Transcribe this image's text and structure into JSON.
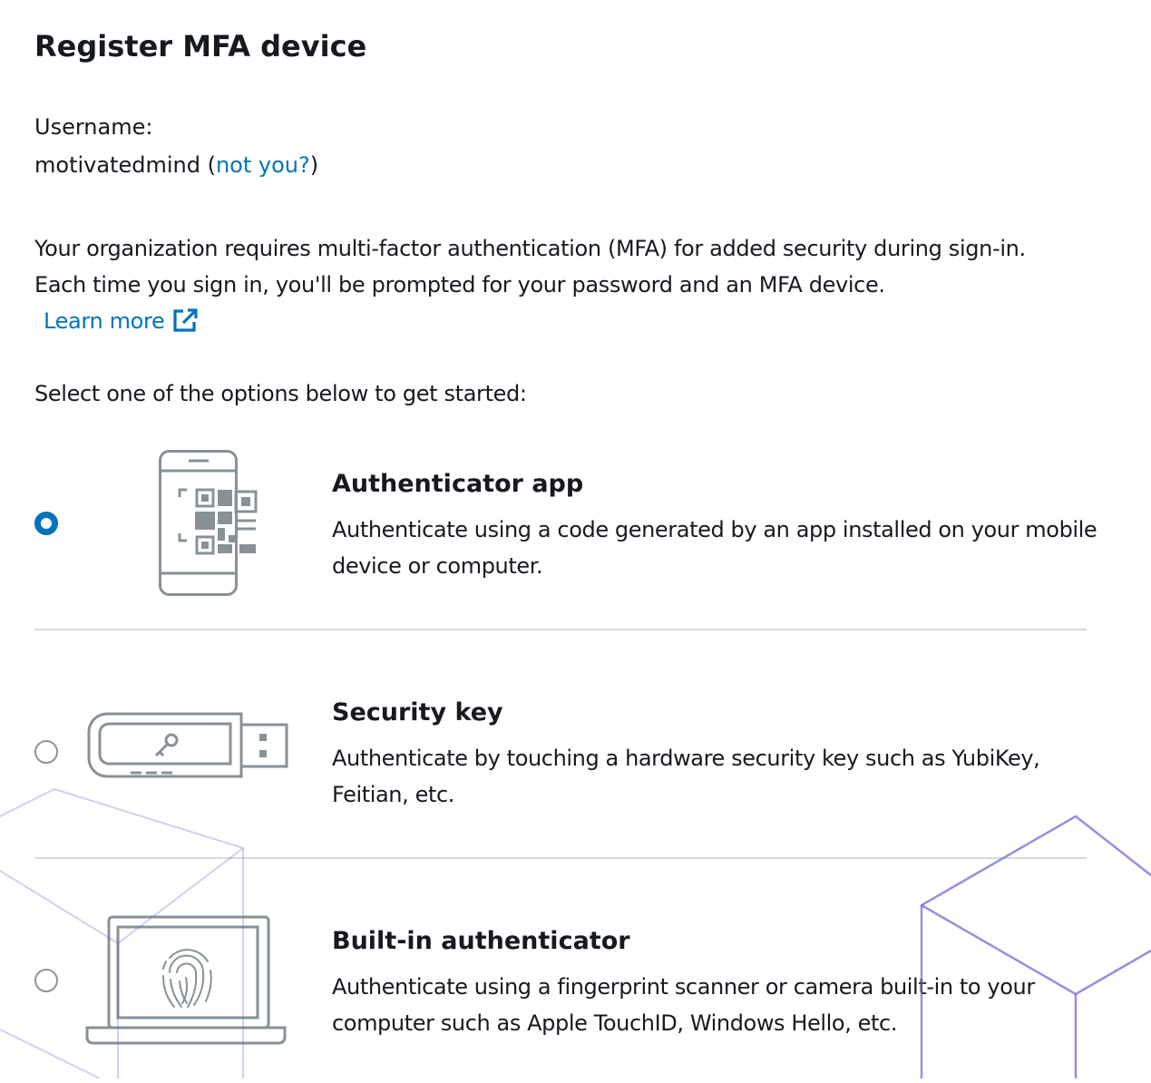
{
  "page": {
    "title": "Register MFA device"
  },
  "user": {
    "label": "Username:",
    "name": "motivatedmind",
    "open_paren": " (",
    "not_you_link": "not you?",
    "close_paren": ")"
  },
  "intro": {
    "text": "Your organization requires multi-factor authentication (MFA) for added security during sign-in. Each time you sign in, you'll be prompted for your password and an MFA device.",
    "learn_more": "Learn more",
    "learn_more_icon": "external-link-icon"
  },
  "prompt": "Select one of the options below to get started:",
  "options": [
    {
      "title": "Authenticator app",
      "description": "Authenticate using a code generated by an app installed on your mobile device or computer.",
      "selected": true,
      "icon": "phone-qr-code-icon"
    },
    {
      "title": "Security key",
      "description": "Authenticate by touching a hardware security key such as YubiKey, Feitian, etc.",
      "selected": false,
      "icon": "usb-security-key-icon"
    },
    {
      "title": "Built-in authenticator",
      "description": "Authenticate using a fingerprint scanner or camera built-in to your computer such as Apple TouchID, Windows Hello, etc.",
      "selected": false,
      "icon": "laptop-fingerprint-icon"
    }
  ],
  "colors": {
    "link": "#0073bb",
    "radio_selected": "#0073bb",
    "radio_unselected": "#8d9596",
    "illustration_stroke": "#879196",
    "divider": "#d5dbdb",
    "decoration": "#6a60d4"
  }
}
